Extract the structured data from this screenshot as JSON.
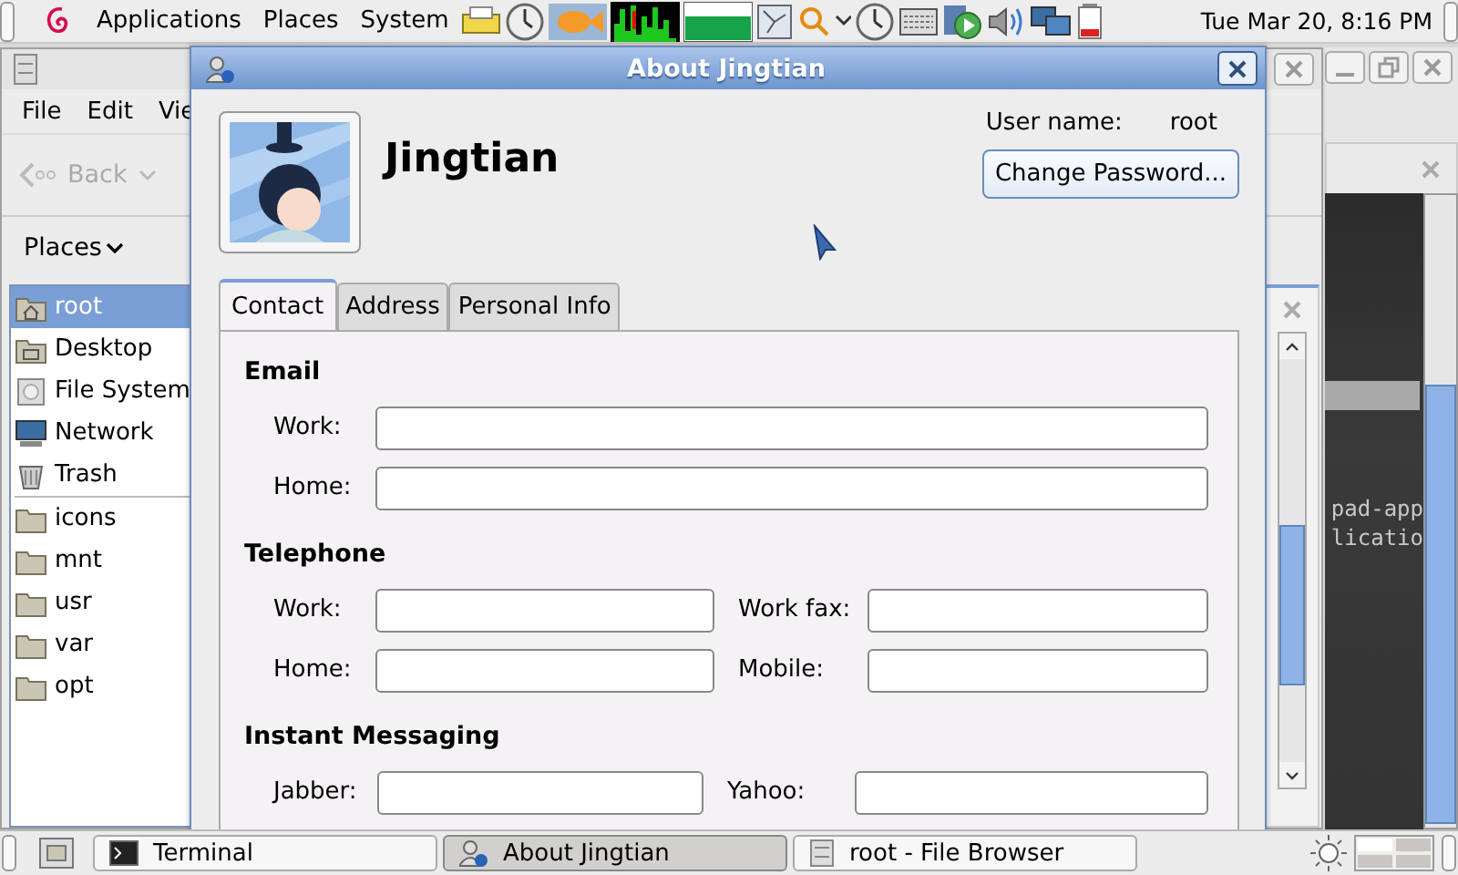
{
  "top_panel": {
    "menus": [
      "Applications",
      "Places",
      "System"
    ],
    "clock": "Tue Mar 20,  8:16 PM"
  },
  "file_browser": {
    "menu": [
      "File",
      "Edit",
      "Vie"
    ],
    "back": "Back",
    "location": "Places",
    "places": [
      {
        "label": "root",
        "kind": "home",
        "selected": true
      },
      {
        "label": "Desktop",
        "kind": "desktop",
        "selected": false
      },
      {
        "label": "File System",
        "kind": "drive",
        "selected": false
      },
      {
        "label": "Network",
        "kind": "network",
        "selected": false
      },
      {
        "label": "Trash",
        "kind": "trash",
        "selected": false
      }
    ],
    "bookmarks": [
      {
        "label": "icons",
        "kind": "folder",
        "selected": false
      },
      {
        "label": "mnt",
        "kind": "folder",
        "selected": false
      },
      {
        "label": "usr",
        "kind": "folder",
        "selected": false
      },
      {
        "label": "var",
        "kind": "folder",
        "selected": false
      },
      {
        "label": "opt",
        "kind": "folder",
        "selected": false
      }
    ]
  },
  "dialog": {
    "title": "About Jingtian",
    "full_name": "Jingtian",
    "user_name_label": "User name:",
    "user_name": "root",
    "change_password": "Change Password...",
    "tabs": [
      {
        "label": "Contact",
        "selected": true
      },
      {
        "label": "Address",
        "selected": false
      },
      {
        "label": "Personal Info",
        "selected": false
      }
    ],
    "sections": [
      {
        "title": "Email",
        "rows": [
          [
            {
              "label": "Work:"
            }
          ],
          [
            {
              "label": "Home:"
            }
          ]
        ]
      },
      {
        "title": "Telephone",
        "rows": [
          [
            {
              "label": "Work:"
            },
            {
              "label": "Work fax:"
            }
          ],
          [
            {
              "label": "Home:"
            },
            {
              "label": "Mobile:"
            }
          ]
        ]
      },
      {
        "title": "Instant Messaging",
        "rows": [
          [
            {
              "label": "Jabber:"
            },
            {
              "label": "Yahoo:"
            }
          ]
        ]
      }
    ]
  },
  "terminal": {
    "lines": [
      "pad-app",
      "licatio"
    ]
  },
  "taskbar": {
    "tasks": [
      {
        "label": "Terminal",
        "kind": "terminal",
        "selected": false
      },
      {
        "label": "About Jingtian",
        "kind": "about",
        "selected": true
      },
      {
        "label": "root - File Browser",
        "kind": "files",
        "selected": false
      }
    ]
  }
}
